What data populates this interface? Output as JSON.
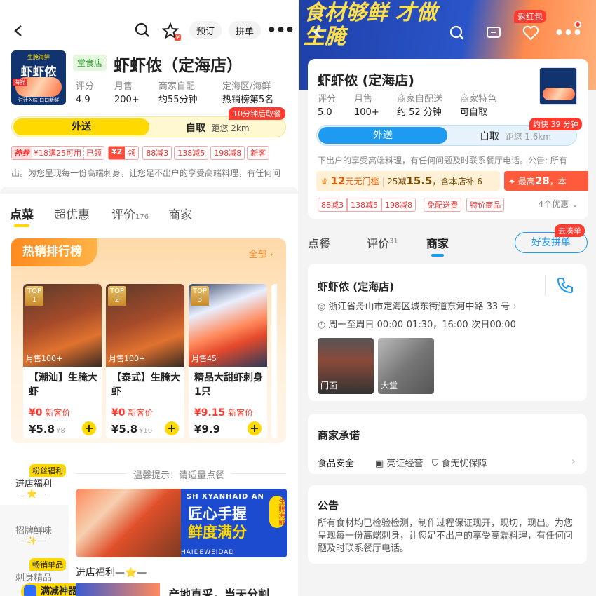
{
  "left": {
    "header": {
      "btn_reserve": "预订",
      "btn_group": "拼单",
      "coupon_badge": "¥"
    },
    "store": {
      "tag": "堂食店",
      "name": "虾虾侬（定海店）",
      "logo_text": "虾虾侬",
      "logo_sub": "生腌海鲜",
      "logo_badge": "海鲜",
      "logo_slogan": "讨汁入味 口口新鲜",
      "stats": [
        {
          "k": "评分",
          "v": "4.9"
        },
        {
          "k": "月售",
          "v": "200+"
        },
        {
          "k": "商家自配",
          "v": "约55分钟"
        },
        {
          "k": "定海区/海鲜",
          "v": "热销榜第5名"
        }
      ]
    },
    "delivery": {
      "tab_delivery": "外送",
      "tab_pickup": "自取",
      "distance": "距您 2km",
      "pickup_badge": "10分钟后取餐"
    },
    "coupons": {
      "c1_label": "神券",
      "c1_value": "¥18满25可用",
      "c1_action": "已领",
      "c2_value": "¥2",
      "c2_action": "领",
      "t1": "88减3",
      "t2": "138减5",
      "t3": "198减8",
      "t4": "新客"
    },
    "notice": "出。为您呈现每一份高端刺身，让您足不出户的享受高端料理，有任何问",
    "tabs": {
      "t1": "点菜",
      "t2": "超优惠",
      "t3": "评价",
      "t3_count": "176",
      "t4": "商家"
    },
    "ranking": {
      "title": "热销排行榜",
      "more": "全部"
    },
    "dishes": [
      {
        "rank": "1",
        "sold": "月售100+",
        "name": "【潮汕】生腌大虾",
        "new_price": "¥0",
        "new_label": "新客价",
        "price": "¥5.8",
        "orig": "¥8"
      },
      {
        "rank": "2",
        "sold": "月售100+",
        "name": "【泰式】生腌大虾",
        "new_price": "¥0",
        "new_label": "新客价",
        "price": "¥5.8",
        "orig": "¥10"
      },
      {
        "rank": "3",
        "sold": "月售45",
        "name": "精品大甜虾刺身1只",
        "new_price": "¥9.15",
        "new_label": "新客价",
        "price": "¥9.9",
        "orig": ""
      }
    ],
    "sidebar": {
      "fans_badge": "粉丝福利",
      "fans_label": "进店福利",
      "fans_star": "—⭐—",
      "s2_label": "招牌鲜味",
      "s2_star": "—✨—",
      "hot_badge": "畅销单品",
      "s3_label": "刺身精品",
      "coupon_tool": "满减神器"
    },
    "tip": "温馨提示：请适量点餐",
    "banner": {
      "top": "SH XYANHAID AN",
      "line1": "匠心手握",
      "line2": "鲜度满分",
      "side": "生腌海鲜",
      "foot": "HAIDEWEIDAD"
    },
    "section_title": "进店福利—⭐—",
    "bottom_item": "产地直采，当天分割"
  },
  "right": {
    "header": {
      "banner_text": "食材够鲜 才做生腌",
      "cashback": "返红包"
    },
    "store": {
      "name": "虾虾侬 (定海店)",
      "stats": [
        {
          "k": "评分",
          "v": "5.0"
        },
        {
          "k": "月售",
          "v": "100+"
        },
        {
          "k": "商家自配送",
          "v": "约 52 分钟"
        },
        {
          "k": "商家特色",
          "v": "可自取"
        }
      ]
    },
    "delivery": {
      "tab_delivery": "外送",
      "tab_pickup": "自取",
      "distance": "距您 1.6km",
      "fast_badge": "约快 39 分钟"
    },
    "notice": "下出户的享受高端料理，有任何问题及时联系餐厅电话。公告: 所有",
    "promo": {
      "free_value": "12",
      "free_unit": "元无门槛",
      "deal": "25减",
      "deal_value": "15.5",
      "deal_tail": "，含本店补 6",
      "max_label": "最高",
      "max_value": "28",
      "max_tail": "，本"
    },
    "tags": {
      "t1": "88减3",
      "t2": "138减5",
      "t3": "198减8",
      "t4": "免配送费",
      "t5": "特价商品",
      "more": "4个优惠"
    },
    "tabs": {
      "t1": "点餐",
      "t2": "评价",
      "t2_count": "31",
      "t3": "商家",
      "friend": "好友拼单",
      "friend_badge": "去凑单"
    },
    "info": {
      "name": "虾虾侬 (定海店)",
      "address": "浙江省舟山市定海区城东街道东河中路 33 号",
      "hours": "周一至周日 00:00-01:30，16:00-次日00:00",
      "photo1": "门面",
      "photo2": "大堂"
    },
    "promise": {
      "title": "商家承诺",
      "food_safety": "食品安全",
      "p1": "亮证经营",
      "p2": "食无忧保障"
    },
    "announcement": {
      "title": "公告",
      "text": "所有食材均已检验检测，制作过程保证现开，现切，现出。为您呈现每一份高端刺身，让您足不出户的享受高端料理，有任何问题及时联系餐厅电话。"
    }
  },
  "colors": {
    "yellow": "#ffd900",
    "red": "#ff3b30",
    "blue": "#1e9bf0",
    "orange": "#ff8a1f"
  }
}
